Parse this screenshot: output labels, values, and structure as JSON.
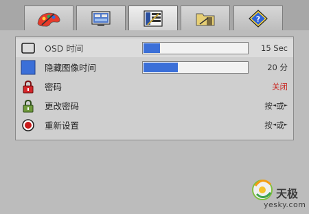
{
  "tabs": [
    {
      "icon": "color-palette-icon",
      "active": false
    },
    {
      "icon": "display-settings-icon",
      "active": false
    },
    {
      "icon": "osd-settings-icon",
      "active": true
    },
    {
      "icon": "tools-folder-icon",
      "active": false
    },
    {
      "icon": "help-icon",
      "active": false
    }
  ],
  "menu": {
    "osd_time": {
      "label": "OSD 时间",
      "level": 0.16,
      "value": "15 Sec",
      "icon": "monitor-outline-icon"
    },
    "hide_image_time": {
      "label": "隐藏图像时间",
      "level": 0.33,
      "value": "20 分",
      "icon": "blue-square-icon"
    },
    "password": {
      "label": "密码",
      "value": "关闭",
      "icon": "red-lock-icon"
    },
    "change_password": {
      "label": "更改密码",
      "value_prefix": "按",
      "value_mid": "或",
      "icon": "green-lock-icon"
    },
    "reset": {
      "label": "重新设置",
      "value_prefix": "按",
      "value_mid": "或",
      "icon": "reset-icon"
    }
  },
  "watermark": {
    "site": "yesky.com",
    "cn": "天极"
  },
  "colors": {
    "accent": "#3b6fd8",
    "off_status": "#c8221c"
  }
}
